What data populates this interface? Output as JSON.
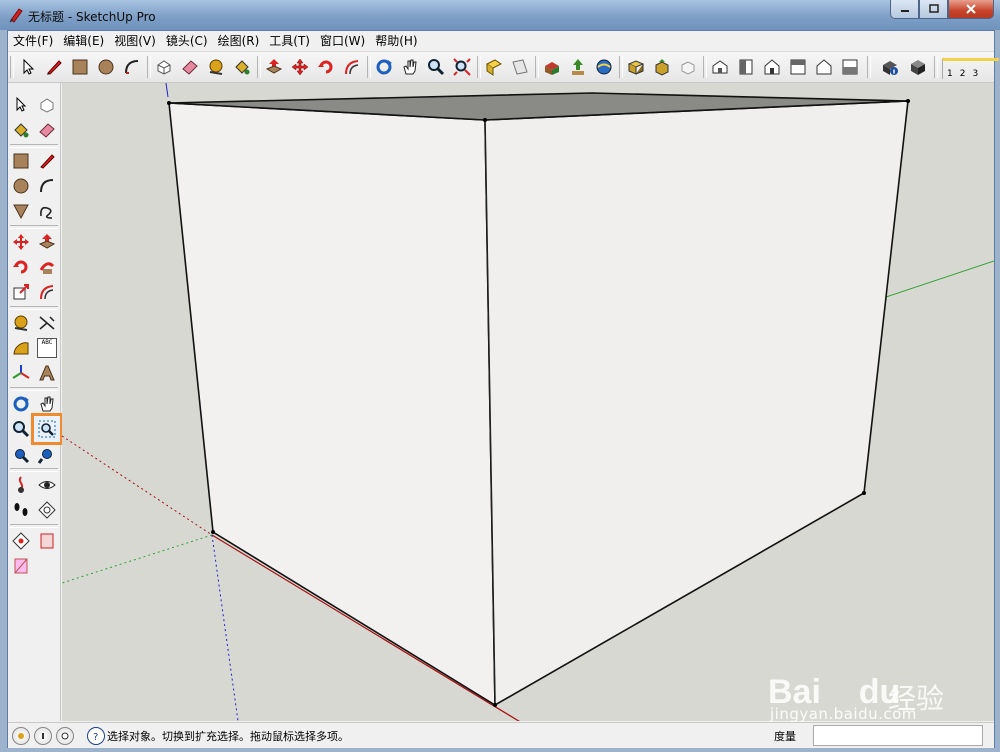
{
  "window": {
    "title": "无标题 - SketchUp Pro",
    "controls": [
      "minimize",
      "maximize",
      "close"
    ]
  },
  "menu": [
    "文件(F)",
    "编辑(E)",
    "视图(V)",
    "镜头(C)",
    "绘图(R)",
    "工具(T)",
    "窗口(W)",
    "帮助(H)"
  ],
  "toolbar": {
    "icons": [
      "select-icon",
      "pencil-icon",
      "rectangle-icon",
      "circle-icon",
      "arc-icon",
      "make-component-icon",
      "eraser-icon",
      "tape-measure-icon",
      "paint-bucket-icon",
      "push-pull-icon",
      "move-icon",
      "rotate-icon",
      "offset-icon",
      "orbit-icon",
      "pan-icon",
      "zoom-icon",
      "zoom-extents-icon",
      "previous-view-icon",
      "next-view-icon",
      "get-models-icon",
      "share-model-icon",
      "warehouse-icon",
      "get-component-icon",
      "share-component-icon",
      "extension-icon",
      "iso-view-icon",
      "top-view-icon",
      "front-view-icon",
      "right-view-icon",
      "back-view-icon",
      "left-view-icon",
      "model-info-icon",
      "xray-icon",
      "scene-tabs-icon"
    ],
    "scene_labels": [
      "1",
      "2",
      "3"
    ]
  },
  "palette": {
    "icons": [
      "select-icon",
      "make-component-icon",
      "paint-bucket-icon",
      "eraser-icon",
      "rectangle-icon",
      "line-icon",
      "circle-icon",
      "arc-icon",
      "polygon-icon",
      "freehand-icon",
      "move-icon",
      "push-pull-icon",
      "rotate-icon",
      "follow-me-icon",
      "scale-icon",
      "offset-icon",
      "tape-measure-icon",
      "dimension-icon",
      "protractor-icon",
      "text-icon",
      "axes-icon",
      "3d-text-icon",
      "orbit-icon",
      "pan-icon",
      "zoom-icon",
      "zoom-window-icon",
      "zoom-extents-icon",
      "previous-icon",
      "position-camera-icon",
      "look-around-icon",
      "walk-icon",
      "section-plane-icon",
      "sandbox-icon",
      "styles-icon",
      "materials-icon"
    ],
    "text_tool_label": "ABC",
    "highlighted": "zoom-window-icon"
  },
  "status": {
    "hint": "选择对象。切换到扩充选择。拖动鼠标选择多项。",
    "measure_label": "度量",
    "measure_value": ""
  },
  "watermark": {
    "brand": "Bai",
    "brand_tail": "du",
    "chinese": "经验",
    "url": "jingyan.baidu.com"
  },
  "colors": {
    "highlight": "#f08a2c",
    "face": "#f0efee",
    "axis_red": "#a51010",
    "axis_green": "#2fa32f",
    "axis_blue": "#2222cc"
  }
}
